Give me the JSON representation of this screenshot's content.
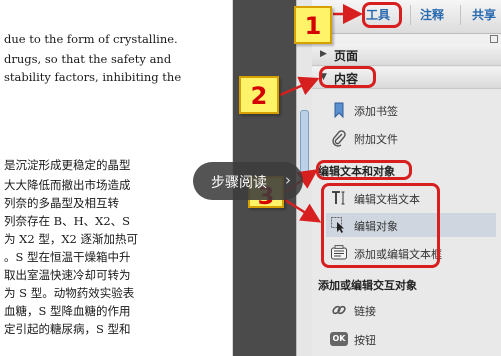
{
  "document": {
    "lines_top": [
      "due to the form of crystalline.",
      "drugs, so that the safety and",
      "stability factors, inhibiting the"
    ],
    "lines_bottom": [
      "是沉淀形成更稳定的晶型",
      "大大降低而撤出市场造成",
      "列奈的多晶型及相互转",
      "列奈存在 B、H、X2、S",
      "为 X2 型，X2 逐渐加热可",
      "。S 型在恒温干燥箱中升",
      "取出室温快速冷却可转为",
      "为 S 型。动物药效实验表",
      "血糖，S 型降血糖的作用",
      "定引起的糖尿病，S 型和"
    ]
  },
  "toolbar": {
    "tabs": [
      "工具",
      "注释",
      "共享"
    ]
  },
  "panel": {
    "section_pages": "页面",
    "section_content": "内容",
    "content_items": [
      "添加书签",
      "附加文件"
    ],
    "group_edit_title": "编辑文本和对象",
    "edit_items": [
      "编辑文档文本",
      "编辑对象",
      "添加或编辑文本框"
    ],
    "group_interactive_title": "添加或编辑交互对象",
    "interactive_items": [
      "链接",
      "按钮"
    ],
    "button_icon_text": "OK"
  },
  "overlay": {
    "label": "步骤阅读",
    "chevron": "›"
  },
  "annotations": {
    "step1": "1",
    "step2": "2",
    "step3": "3"
  },
  "colors": {
    "tab_text": "#2a6ab0",
    "badge_fill": "#fff36a",
    "badge_text": "#d40000",
    "ring": "#d81f1f",
    "gutter": "#4b4b4b"
  }
}
